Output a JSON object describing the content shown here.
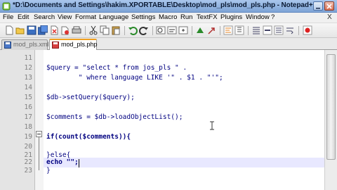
{
  "window": {
    "title": "*D:\\Documents and Settings\\hakim.XPORTABLE\\Desktop\\mod_pls\\mod_pls.php - Notepad++",
    "minimize_glyph": "_",
    "close_glyph": "x"
  },
  "menu": {
    "items": [
      "File",
      "Edit",
      "Search",
      "View",
      "Format",
      "Language",
      "Settings",
      "Macro",
      "Run",
      "TextFX",
      "Plugins",
      "Window",
      "?"
    ],
    "close_glyph": "X"
  },
  "toolbar": {
    "icons": [
      "new-file-icon",
      "open-file-icon",
      "save-icon",
      "save-all-icon",
      "close-file-icon",
      "close-all-icon",
      "print-icon",
      "cut-icon",
      "copy-icon",
      "paste-icon",
      "undo-icon",
      "redo-icon",
      "find-icon",
      "replace-icon",
      "zoom-in-icon",
      "zoom-out-icon",
      "sync-scroll-icon",
      "wrap-icon",
      "show-all-chars-icon",
      "indent-guide-icon",
      "record-macro-icon"
    ]
  },
  "tabs": [
    {
      "label": "mod_pls.xml",
      "active": false
    },
    {
      "label": "mod_pls.php",
      "active": true
    }
  ],
  "editor": {
    "lines": [
      {
        "num": "11",
        "text": ""
      },
      {
        "num": "12",
        "text": "$query = \"select * from jos_pls \" ."
      },
      {
        "num": "13",
        "text": "        \" where language LIKE '\" . $1 . \"'\";"
      },
      {
        "num": "14",
        "text": ""
      },
      {
        "num": "15",
        "text": "$db->setQuery($query);"
      },
      {
        "num": "16",
        "text": ""
      },
      {
        "num": "17",
        "text": "$comments = $db->loadObjectList();"
      },
      {
        "num": "18",
        "text": ""
      },
      {
        "num": "19",
        "text": "if(count($comments)){"
      },
      {
        "num": "20",
        "text": ""
      },
      {
        "num": "21",
        "text": "}else{"
      },
      {
        "num": "22",
        "text": "echo \"\";"
      },
      {
        "num": "23",
        "text": "}"
      }
    ],
    "current_line": "22"
  },
  "colors": {
    "titlebar": "#8eb1e0",
    "current_line": "#e8e8ff",
    "code_text": "#000080",
    "line_number": "#808080"
  }
}
